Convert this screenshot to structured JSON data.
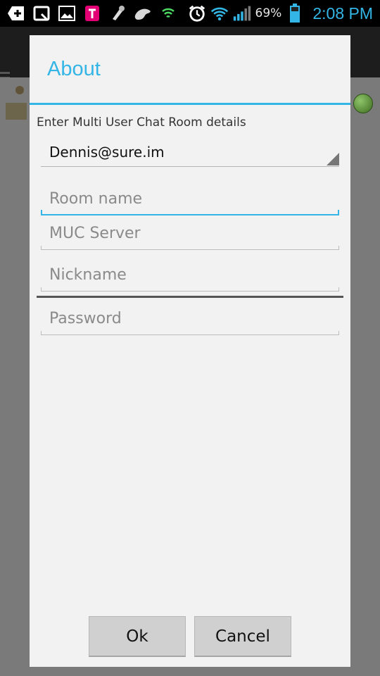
{
  "status_bar": {
    "left_icons": [
      "add-icon",
      "quick-memo-icon",
      "gallery-icon",
      "t-mobile-icon",
      "settings-brush-icon",
      "tiger-icon",
      "cell-signal-app-icon"
    ],
    "right_icons": [
      "alarm-clock-icon",
      "wifi-icon",
      "signal-strength-icon",
      "battery-icon"
    ],
    "battery_percent": "69%",
    "time": "2:08 PM",
    "accent_color": "#33b5e5"
  },
  "dialog": {
    "title": "About",
    "prompt": "Enter Multi User Chat Room details",
    "account_spinner": {
      "value": "Dennis@sure.im"
    },
    "fields": {
      "room_name": {
        "placeholder": "Room name",
        "value": ""
      },
      "muc_server": {
        "placeholder": "MUC Server",
        "value": ""
      },
      "nickname": {
        "placeholder": "Nickname",
        "value": ""
      },
      "password": {
        "placeholder": "Password",
        "value": ""
      }
    },
    "buttons": {
      "ok": "Ok",
      "cancel": "Cancel"
    }
  }
}
